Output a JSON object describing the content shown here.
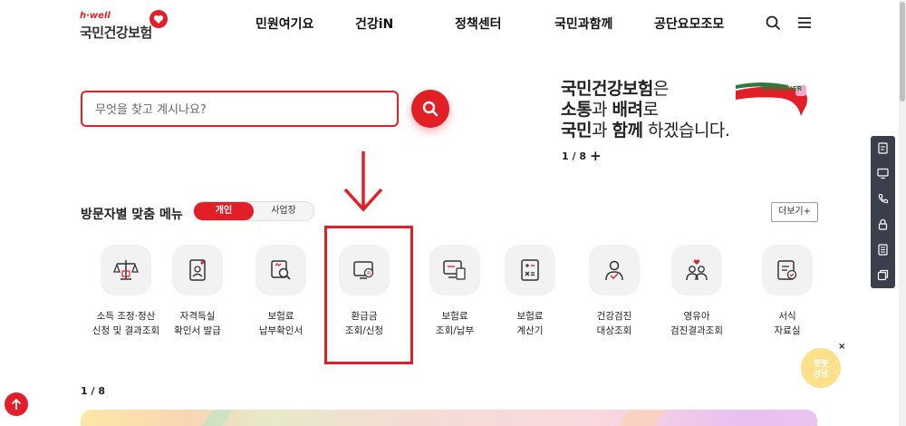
{
  "header": {
    "logo_small": "h·well",
    "logo_main": "국민건강보험",
    "nav": [
      "민원여기요",
      "건강iN",
      "정책센터",
      "국민과함께",
      "공단요모조모"
    ]
  },
  "search": {
    "placeholder": "무엇을 찾고 계시나요?"
  },
  "banner": {
    "line1_bold": "국민건강보험",
    "line1_rest": "은",
    "line2_bold1": "소통",
    "line2_mid": "과 ",
    "line2_bold2": "배려",
    "line2_rest": "로",
    "line3_bold1": "국민",
    "line3_mid": "과 ",
    "line3_bold2": "함께",
    "line3_rest": " 하겠습니다.",
    "graphic_text": "HEALTHIER",
    "pager": "1 / 8",
    "plus": "+"
  },
  "menu": {
    "title": "방문자별 맞춤 메뉴",
    "toggle_personal": "개인",
    "toggle_business": "사업장",
    "more": "더보기+",
    "items": [
      {
        "label": "소득 조정·정산\n신청 및 결과조회",
        "icon": "scale-icon"
      },
      {
        "label": "자격득실\n확인서 발급",
        "icon": "id-card-icon"
      },
      {
        "label": "보험료\n납부확인서",
        "icon": "receipt-search-icon"
      },
      {
        "label": "환급금\n조회/신청",
        "icon": "refund-monitor-icon"
      },
      {
        "label": "보험료\n조회/납부",
        "icon": "payment-monitor-icon"
      },
      {
        "label": "보험료\n계산기",
        "icon": "calculator-icon"
      },
      {
        "label": "건강검진\n대상조회",
        "icon": "checkup-person-icon"
      },
      {
        "label": "영유아\n검진결과조회",
        "icon": "family-heart-icon"
      },
      {
        "label": "서식\n자료실",
        "icon": "form-document-icon"
      }
    ],
    "pager": "1 / 8"
  },
  "chatbot": {
    "line1": "챗봇",
    "line2": "상담",
    "close": "×"
  },
  "colors": {
    "brand_red": "#e21f26",
    "quickbar": "#3a3f4b"
  }
}
